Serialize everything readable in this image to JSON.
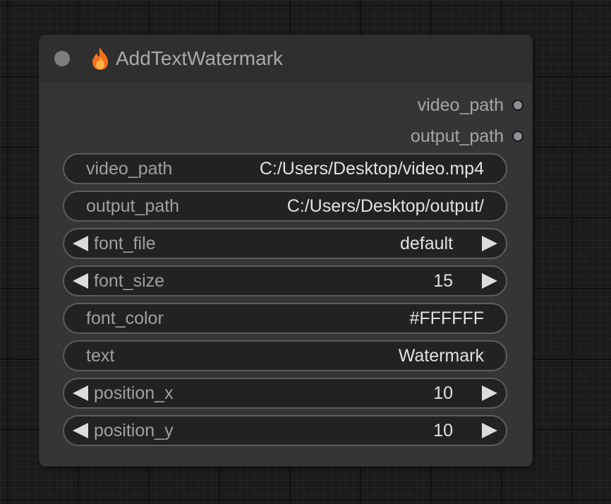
{
  "node": {
    "title": "AddTextWatermark",
    "title_icon": "flame-icon",
    "outputs": [
      {
        "label": "video_path"
      },
      {
        "label": "output_path"
      }
    ],
    "widgets": {
      "video_path": {
        "label": "video_path",
        "value": "C:/Users/Desktop/video.mp4"
      },
      "output_path": {
        "label": "output_path",
        "value": "C:/Users/Desktop/output/"
      },
      "font_file": {
        "label": "font_file",
        "value": "default"
      },
      "font_size": {
        "label": "font_size",
        "value": "15"
      },
      "font_color": {
        "label": "font_color",
        "value": "#FFFFFF"
      },
      "text": {
        "label": "text",
        "value": "Watermark"
      },
      "position_x": {
        "label": "position_x",
        "value": "10"
      },
      "position_y": {
        "label": "position_y",
        "value": "10"
      }
    }
  },
  "colors": {
    "canvas_background": "#1b1b1b",
    "node_body": "#353535",
    "widget_background": "#222222",
    "flame_orange": "#f57c1f"
  }
}
